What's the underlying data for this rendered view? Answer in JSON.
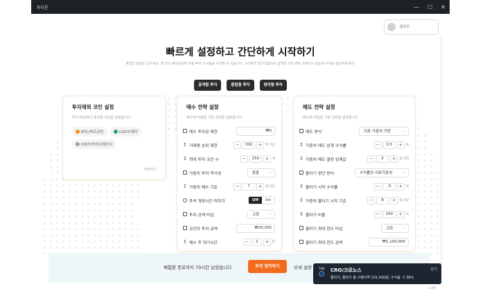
{
  "window": {
    "title": "투다운",
    "btn_min": "—",
    "btn_max": "☐",
    "btn_close": "✕"
  },
  "profile": {
    "name": "정우진"
  },
  "hero": {
    "title": "빠르게 설정하고 간단하게 시작하기",
    "subtitle": "복잡한 설정은 잊으세요. 몇 번의 클릭만으로 자동 투자 시스템을 시작할 수 있습니다. 스마트한 알고리즘으로 급격한 시장 변화 속에서도 손쉽게 수익을 챙길어보세요!"
  },
  "strategy_tabs": [
    "공격형 투자",
    "중립형 투자",
    "방어형 투자"
  ],
  "exclude": {
    "title": "투자제외 코인 설정",
    "desc": "투자 대상에서 제외할 코인을 설정합니다.",
    "coins": [
      {
        "label": "BTC/비트코인",
        "color": "#f7931a"
      },
      {
        "label": "USDT/테더",
        "color": "#26a17b"
      },
      {
        "label": "IOST/아이오에스티",
        "color": "#9aa3ad"
      }
    ],
    "edit": "수정하기"
  },
  "buy": {
    "title": "매수 전략 설정",
    "desc": "매수에 적용될 기본 전략을 설정합니다.",
    "rows": [
      {
        "icon": "▣",
        "label": "매수 투자금 제한",
        "value": "₩0"
      },
      {
        "icon": "↕",
        "label": "거래량 순위 제한",
        "value": "300",
        "unit": "위 이상"
      },
      {
        "icon": "↕",
        "label": "최대 투자 코인 수",
        "value": "150",
        "unit": "개"
      },
      {
        "icon": "☰",
        "label": "가중치 투자 적극성",
        "value": "중중"
      },
      {
        "icon": "↕",
        "label": "가중치 매수 기준",
        "value": "7",
        "unit": "점 이상"
      },
      {
        "icon": "◉",
        "label": "추석 개장시간 피하기",
        "off": "Off",
        "on": "On"
      },
      {
        "icon": "☰",
        "label": "투자 금액 타입",
        "value": "고정"
      },
      {
        "icon": "▣",
        "label": "코인당 투자 금액",
        "value": "₩20,000"
      },
      {
        "icon": "↕",
        "label": "매수 후 대기시간",
        "value": "2",
        "unit": "분"
      }
    ]
  },
  "sell": {
    "title": "매도 전략 설정",
    "desc": "매도에 적용될 기본 전략을 설정합니다.",
    "rows": [
      {
        "icon": "☰",
        "label": "매도 방식",
        "value": "지표 가중치 기반"
      },
      {
        "icon": "↕",
        "label": "가중치 매도 임계 수익률",
        "value": "0.5",
        "unit": "%"
      },
      {
        "icon": "↕",
        "label": "가중치 매도 결정 임계값",
        "value": "5",
        "unit": "점 이하"
      },
      {
        "icon": "☰",
        "label": "물타기 판단 방식",
        "value": "수익률과 지표가중치"
      },
      {
        "icon": "↕",
        "label": "물타기 시작 수익률",
        "value": "-5",
        "unit": "%"
      },
      {
        "icon": "↕",
        "label": "가중치 물타기 시작 기준",
        "value": "8",
        "unit": "점 이상"
      },
      {
        "icon": "↕",
        "label": "물타기 비율",
        "value": "100",
        "unit": "%"
      },
      {
        "icon": "☰",
        "label": "물타기 최대 한도 타입",
        "value": "고정"
      },
      {
        "icon": "▣",
        "label": "물타기 최대 한도 금액",
        "value": "₩1,100,000"
      }
    ]
  },
  "stepper": {
    "minus": "−",
    "plus": "+"
  },
  "banner": {
    "text": "체험판 종료까지 79시간 남았습니다",
    "button": "투자 정지하기",
    "detail": "상세 설정"
  },
  "toast": {
    "icon_label": "73회",
    "title": "CRO/크로노스",
    "body": "물타기, 물타기 총 구매가격 101,500원, 수익률 -7.38%",
    "close": "닫기"
  },
  "corner": "13분"
}
